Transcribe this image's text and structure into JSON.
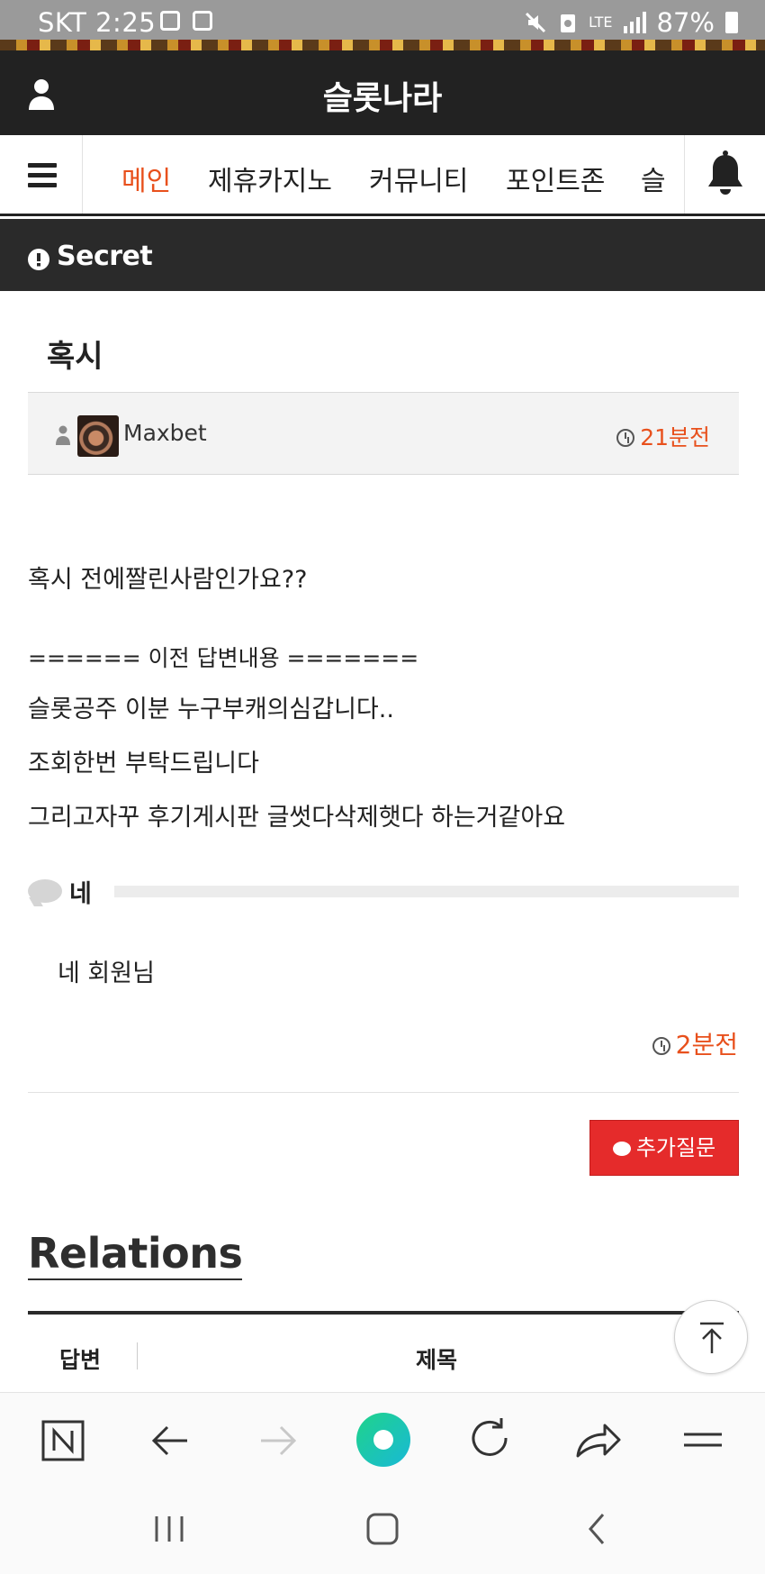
{
  "status_bar": {
    "carrier_time": "SKT 2:25",
    "network": "LTE",
    "battery": "87%"
  },
  "header": {
    "site_title": "슬롯나라"
  },
  "nav": {
    "items": [
      {
        "label": "메인",
        "active": true
      },
      {
        "label": "제휴카지노"
      },
      {
        "label": "커뮤니티"
      },
      {
        "label": "포인트존"
      },
      {
        "label": "슬"
      }
    ]
  },
  "section_bar": {
    "label": "Secret"
  },
  "post": {
    "title": "혹시",
    "author": "Maxbet",
    "time": "21분전",
    "body": [
      "혹시 전에짤린사람인가요??",
      "====== 이전 답변내용 =======",
      "슬롯공주 이분 누구부캐의심갑니다..",
      "조회한번 부탁드립니다",
      "그리고자꾸 후기게시판 글썻다삭제햇다 하는거같아요"
    ]
  },
  "answer": {
    "label": "네",
    "text": "네 회원님",
    "time": "2분전"
  },
  "buttons": {
    "add_question": "추가질문"
  },
  "relations": {
    "heading": "Relations",
    "col_answer": "답변",
    "col_title": "제목"
  },
  "colors": {
    "accent": "#e8501c",
    "header_bg": "#222222",
    "button_red": "#e52b2b"
  },
  "icons": {
    "user": "user-icon",
    "menu": "hamburger-icon",
    "bell": "bell-icon",
    "secret": "exclamation-circle-icon",
    "clock": "clock-icon",
    "comment": "comment-icon",
    "scroll_top": "arrow-up-icon",
    "browser": [
      "naver-n-icon",
      "back-arrow-icon",
      "forward-arrow-icon",
      "home-circle-icon",
      "reload-icon",
      "share-icon",
      "menu-lines-icon"
    ],
    "system": [
      "recent-apps-icon",
      "home-icon",
      "back-icon"
    ]
  }
}
